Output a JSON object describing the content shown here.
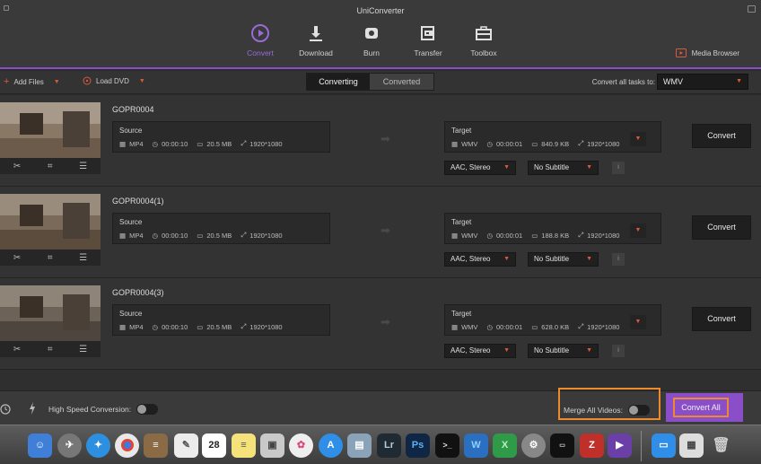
{
  "app_title": "UniConverter",
  "nav": [
    {
      "label": "Convert",
      "icon": "convert-icon",
      "active": true
    },
    {
      "label": "Download",
      "icon": "download-icon",
      "active": false
    },
    {
      "label": "Burn",
      "icon": "burn-icon",
      "active": false
    },
    {
      "label": "Transfer",
      "icon": "transfer-icon",
      "active": false
    },
    {
      "label": "Toolbox",
      "icon": "toolbox-icon",
      "active": false
    }
  ],
  "media_browser": {
    "label": "Media Browser",
    "icon": "media-browser-icon"
  },
  "toolbar": {
    "add_files": "Add Files",
    "load_dvd": "Load DVD",
    "tabs": [
      {
        "label": "Converting",
        "active": true
      },
      {
        "label": "Converted",
        "active": false
      }
    ],
    "convert_all_to": "Convert all tasks to:",
    "format": "WMV"
  },
  "files": [
    {
      "name": "GOPR0004",
      "source": {
        "title": "Source",
        "format": "MP4",
        "duration": "00:00:10",
        "size": "20.5 MB",
        "resolution": "1920*1080"
      },
      "target": {
        "title": "Target",
        "format": "WMV",
        "duration": "00:00:01",
        "size": "840.9 KB",
        "resolution": "1920*1080"
      },
      "audio": "AAC, Stereo",
      "subtitle": "No Subtitle",
      "convert_label": "Convert",
      "info_label": "i"
    },
    {
      "name": "GOPR0004(1)",
      "source": {
        "title": "Source",
        "format": "MP4",
        "duration": "00:00:10",
        "size": "20.5 MB",
        "resolution": "1920*1080"
      },
      "target": {
        "title": "Target",
        "format": "WMV",
        "duration": "00:00:01",
        "size": "188.8 KB",
        "resolution": "1920*1080"
      },
      "audio": "AAC, Stereo",
      "subtitle": "No Subtitle",
      "convert_label": "Convert",
      "info_label": "i"
    },
    {
      "name": "GOPR0004(3)",
      "source": {
        "title": "Source",
        "format": "MP4",
        "duration": "00:00:10",
        "size": "20.5 MB",
        "resolution": "1920*1080"
      },
      "target": {
        "title": "Target",
        "format": "WMV",
        "duration": "00:00:01",
        "size": "628.0 KB",
        "resolution": "1920*1080"
      },
      "audio": "AAC, Stereo",
      "subtitle": "No Subtitle",
      "convert_label": "Convert",
      "info_label": "i"
    }
  ],
  "bottom": {
    "high_speed_label": "High Speed Conversion:",
    "high_speed_on": false,
    "merge_label": "Merge All Videos:",
    "merge_on": false,
    "convert_all": "Convert All"
  },
  "dock": {
    "calendar_day": "28",
    "lightroom": "Lr",
    "photoshop": "Ps",
    "terminal": ">_",
    "filezilla": "Z",
    "w_app": "W",
    "x_app": "X"
  },
  "colors": {
    "accent": "#8a4fc8",
    "highlight": "#ee8a2e",
    "caret": "#d65a3c"
  }
}
